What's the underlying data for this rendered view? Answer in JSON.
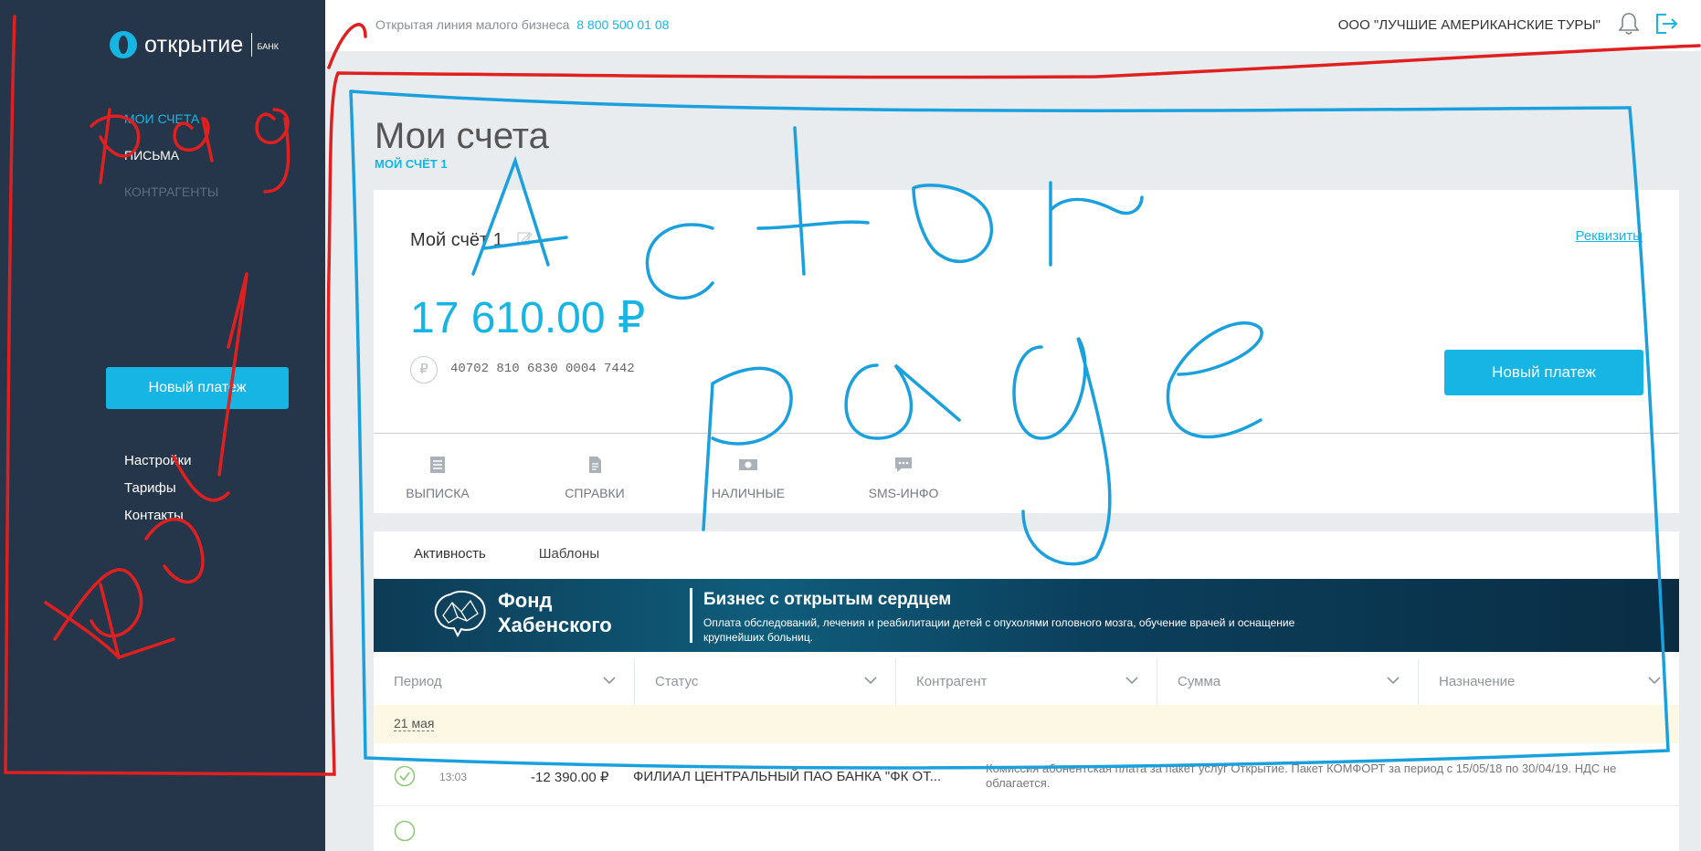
{
  "sidebar": {
    "logo_name": "открытие",
    "logo_bank": "БАНК",
    "nav": [
      {
        "label": "МОИ СЧЕТА"
      },
      {
        "label": "ПИСЬМА"
      },
      {
        "label": "КОНТРАГЕНТЫ"
      }
    ],
    "new_payment_label": "Новый платеж",
    "links": [
      {
        "label": "Настройки"
      },
      {
        "label": "Тарифы"
      },
      {
        "label": "Контакты"
      }
    ]
  },
  "header": {
    "hotline_label": "Открытая линия малого бизнеса",
    "hotline_phone": "8 800 500 01 08",
    "company": "ООО \"ЛУЧШИЕ АМЕРИКАНСКИЕ ТУРЫ\""
  },
  "main": {
    "title": "Мои счета",
    "breadcrumb": "МОЙ СЧЁТ 1",
    "account": {
      "name": "Мой счёт 1",
      "details_link": "Реквизиты",
      "balance": "17 610.00 ₽",
      "currency_symbol": "₽",
      "number": "40702 810 6830 0004 7442",
      "new_payment_label": "Новый платеж"
    },
    "actions": [
      {
        "label": "ВЫПИСКА",
        "icon": "statement-icon"
      },
      {
        "label": "СПРАВКИ",
        "icon": "document-icon"
      },
      {
        "label": "НАЛИЧНЫЕ",
        "icon": "cash-icon"
      },
      {
        "label": "SMS-ИНФО",
        "icon": "sms-icon"
      }
    ],
    "tabs": [
      {
        "label": "Активность",
        "active": true
      },
      {
        "label": "Шаблоны",
        "active": false
      }
    ],
    "banner": {
      "fund_name": "Фонд Хабенского",
      "title": "Бизнес с открытым сердцем",
      "text": "Оплата обследований, лечения и реабилитации детей с опухолями головного мозга, обучение врачей и оснащение крупнейших больниц."
    },
    "filters": [
      {
        "label": "Период"
      },
      {
        "label": "Статус"
      },
      {
        "label": "Контрагент"
      },
      {
        "label": "Сумма"
      },
      {
        "label": "Назначение"
      }
    ],
    "date_group": "21 мая",
    "transactions": [
      {
        "time": "13:03",
        "amount": "-12 390.00 ₽",
        "counterparty": "ФИЛИАЛ ЦЕНТРАЛЬНЫЙ ПАО БАНКА \"ФК ОТ...",
        "purpose": "Комиссия абонентская плата за пакет услуг Открытие. Пакет КОМФОРТ за период с 15/05/18 по 30/04/19. НДС не облагается.",
        "status": "completed"
      }
    ]
  },
  "annotations": {
    "color_red": "#e02020",
    "color_blue": "#1aa0dc"
  },
  "colors": {
    "accent": "#17b5e3",
    "sidebar_bg": "#26364a",
    "page_bg": "#e9ecee"
  }
}
